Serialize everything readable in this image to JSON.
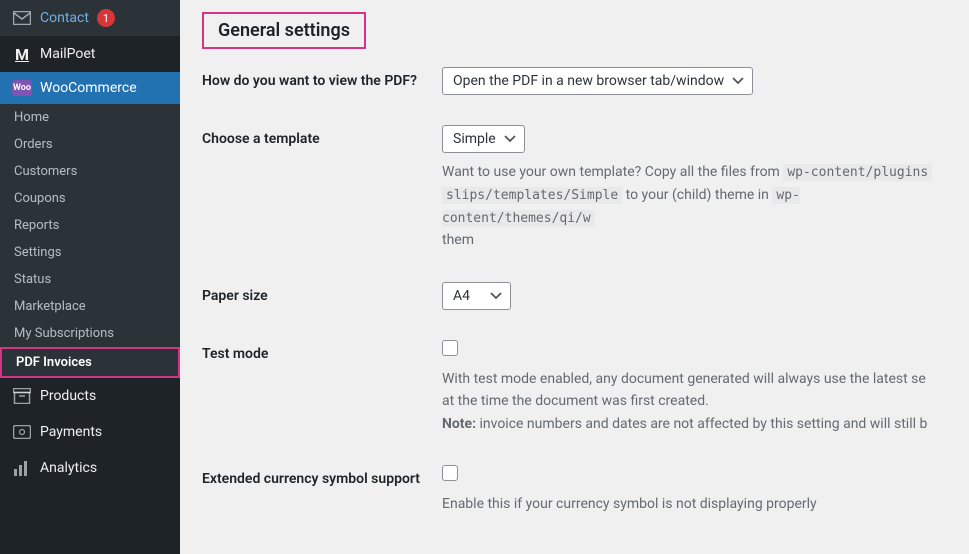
{
  "sidebar": {
    "contact": {
      "label": "Contact",
      "badge": "1"
    },
    "mailpoet": {
      "label": "MailPoet"
    },
    "woocommerce": {
      "label": "WooCommerce"
    },
    "sub": [
      {
        "label": "Home"
      },
      {
        "label": "Orders"
      },
      {
        "label": "Customers"
      },
      {
        "label": "Coupons"
      },
      {
        "label": "Reports"
      },
      {
        "label": "Settings"
      },
      {
        "label": "Status"
      },
      {
        "label": "Marketplace"
      },
      {
        "label": "My Subscriptions"
      },
      {
        "label": "PDF Invoices"
      }
    ],
    "products": {
      "label": "Products"
    },
    "payments": {
      "label": "Payments"
    },
    "analytics": {
      "label": "Analytics"
    }
  },
  "page": {
    "heading": "General settings",
    "view_pdf": {
      "label": "How do you want to view the PDF?",
      "value": "Open the PDF in a new browser tab/window"
    },
    "template": {
      "label": "Choose a template",
      "value": "Simple",
      "desc_before": "Want to use your own template? Copy all the files from ",
      "code1": "wp-content/plugins",
      "code2": "slips/templates/Simple",
      "desc_mid": " to your (child) theme in ",
      "code3": "wp-content/themes/qi/w",
      "desc_after": "them"
    },
    "paper": {
      "label": "Paper size",
      "value": "A4"
    },
    "testmode": {
      "label": "Test mode",
      "desc1": "With test mode enabled, any document generated will always use the latest se",
      "desc2": "at the time the document was first created.",
      "note_label": "Note:",
      "note_text": " invoice numbers and dates are not affected by this setting and will still b"
    },
    "currency": {
      "label": "Extended currency symbol support",
      "desc": "Enable this if your currency symbol is not displaying properly"
    }
  }
}
